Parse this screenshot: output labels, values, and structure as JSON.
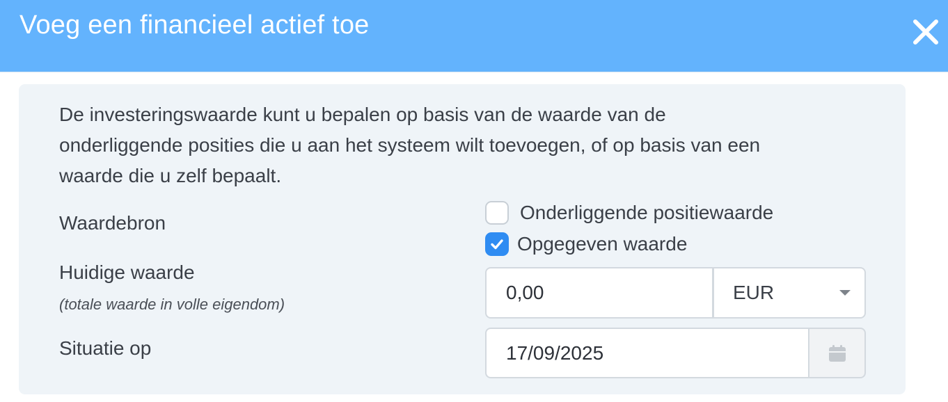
{
  "dialog": {
    "title": "Voeg een financieel actief toe",
    "close_icon": "close-icon",
    "header_color": "#63b3fd"
  },
  "form": {
    "intro_lines": [
      "De investeringswaarde kunt u bepalen op basis van de waarde van de",
      "onderliggende posities die u aan het systeem wilt toevoegen, of op basis van een",
      "waarde die u zelf bepaalt."
    ],
    "value_source": {
      "label": "Waardebron",
      "options": [
        {
          "label": "Onderliggende positiewaarde",
          "checked": false
        },
        {
          "label": "Opgegeven waarde",
          "checked": true
        }
      ]
    },
    "current_value": {
      "label": "Huidige waarde",
      "sublabel": "(totale waarde in volle eigendom)",
      "amount": "0,00",
      "currency": "EUR"
    },
    "situation": {
      "label": "Situatie op",
      "date": "17/09/2025",
      "calendar_icon": "calendar-icon"
    },
    "accent_color": "#2f8cf2"
  }
}
